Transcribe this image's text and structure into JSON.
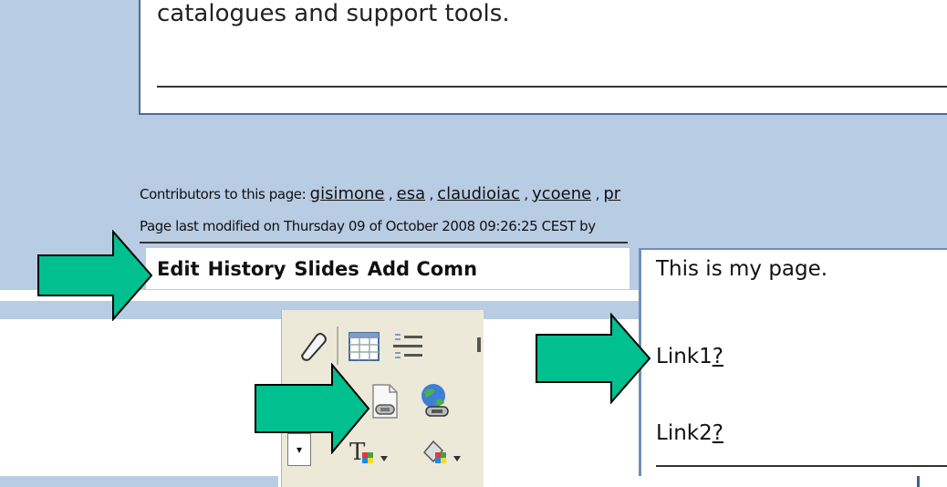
{
  "content": {
    "text": "catalogues and support tools."
  },
  "footer": {
    "contributors_label": "Contributors to this page:",
    "contributors": [
      "gisimone",
      "esa",
      "claudioiac",
      "ycoene",
      "pr"
    ],
    "separator": ",",
    "last_modified": "Page last modified on Thursday 09 of October 2008 09:26:25 CEST by"
  },
  "actions": {
    "edit": "Edit",
    "history": "History",
    "slides": "Slides",
    "add_comment": "Add Comn"
  },
  "editor": {
    "line1": "This is my page.",
    "link1_text": "Link1",
    "link1_marker": "?",
    "link2_text": "Link2",
    "link2_marker": "?"
  },
  "toolbar": {
    "icons": [
      "eraser-icon",
      "table-icon",
      "list-icon",
      "page-link-icon",
      "external-link-icon",
      "text-color-icon",
      "background-color-icon"
    ],
    "dropdown_symbol": "▾"
  },
  "colors": {
    "page_bg": "#b8cce4",
    "arrow_fill": "#00c090",
    "border": "#4a6c99"
  }
}
